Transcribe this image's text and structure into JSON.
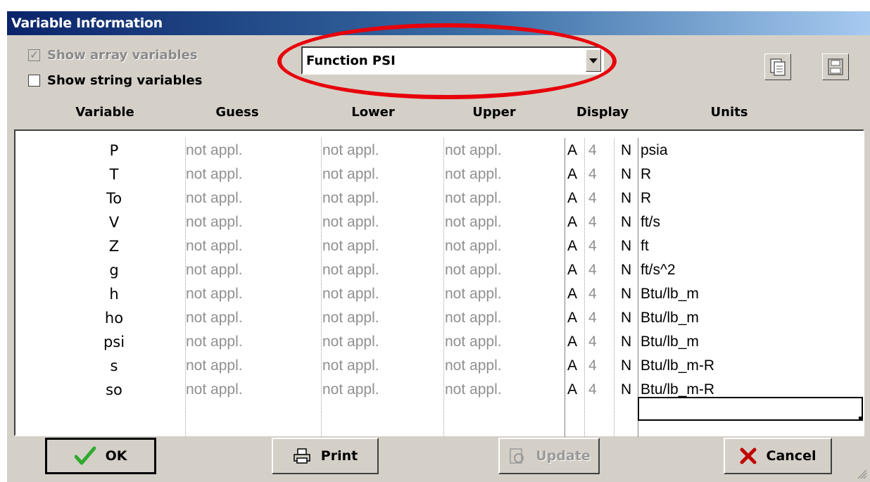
{
  "window": {
    "title": "Variable Information"
  },
  "options": {
    "show_array_label": "Show array variables",
    "show_string_label": "Show string variables"
  },
  "function_select": {
    "value": "Function PSI"
  },
  "columns": {
    "variable": "Variable",
    "guess": "Guess",
    "lower": "Lower",
    "upper": "Upper",
    "display": "Display",
    "units": "Units"
  },
  "rows": [
    {
      "var": "P",
      "guess": "not appl.",
      "lower": "not appl.",
      "upper": "not appl.",
      "fmt": "A",
      "digits": "4",
      "mode": "N",
      "units": "psia"
    },
    {
      "var": "T",
      "guess": "not appl.",
      "lower": "not appl.",
      "upper": "not appl.",
      "fmt": "A",
      "digits": "4",
      "mode": "N",
      "units": "R"
    },
    {
      "var": "To",
      "guess": "not appl.",
      "lower": "not appl.",
      "upper": "not appl.",
      "fmt": "A",
      "digits": "4",
      "mode": "N",
      "units": "R"
    },
    {
      "var": "V",
      "guess": "not appl.",
      "lower": "not appl.",
      "upper": "not appl.",
      "fmt": "A",
      "digits": "4",
      "mode": "N",
      "units": "ft/s"
    },
    {
      "var": "Z",
      "guess": "not appl.",
      "lower": "not appl.",
      "upper": "not appl.",
      "fmt": "A",
      "digits": "4",
      "mode": "N",
      "units": "ft"
    },
    {
      "var": "g",
      "guess": "not appl.",
      "lower": "not appl.",
      "upper": "not appl.",
      "fmt": "A",
      "digits": "4",
      "mode": "N",
      "units": "ft/s^2"
    },
    {
      "var": "h",
      "guess": "not appl.",
      "lower": "not appl.",
      "upper": "not appl.",
      "fmt": "A",
      "digits": "4",
      "mode": "N",
      "units": "Btu/lb_m"
    },
    {
      "var": "ho",
      "guess": "not appl.",
      "lower": "not appl.",
      "upper": "not appl.",
      "fmt": "A",
      "digits": "4",
      "mode": "N",
      "units": "Btu/lb_m"
    },
    {
      "var": "psi",
      "guess": "not appl.",
      "lower": "not appl.",
      "upper": "not appl.",
      "fmt": "A",
      "digits": "4",
      "mode": "N",
      "units": "Btu/lb_m"
    },
    {
      "var": "s",
      "guess": "not appl.",
      "lower": "not appl.",
      "upper": "not appl.",
      "fmt": "A",
      "digits": "4",
      "mode": "N",
      "units": "Btu/lb_m-R"
    },
    {
      "var": "so",
      "guess": "not appl.",
      "lower": "not appl.",
      "upper": "not appl.",
      "fmt": "A",
      "digits": "4",
      "mode": "N",
      "units": "Btu/lb_m-R"
    }
  ],
  "buttons": {
    "ok": "OK",
    "print": "Print",
    "update": "Update",
    "cancel": "Cancel"
  },
  "colors": {
    "highlight_ellipse": "#e8000a",
    "ok_check": "#2eaa2e",
    "cancel_x": "#c00000"
  }
}
